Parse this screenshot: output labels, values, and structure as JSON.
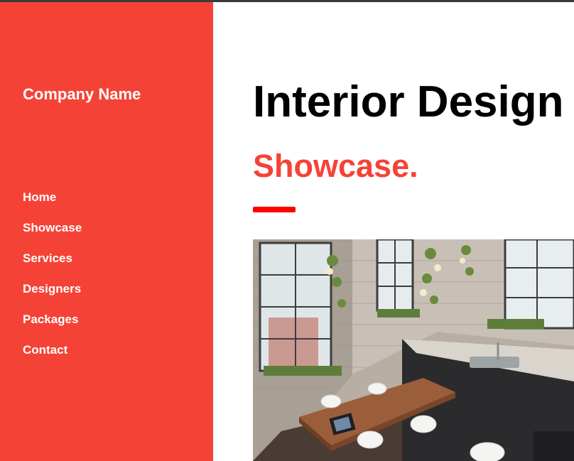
{
  "sidebar": {
    "brand": "Company Name",
    "items": [
      {
        "label": "Home"
      },
      {
        "label": "Showcase"
      },
      {
        "label": "Services"
      },
      {
        "label": "Designers"
      },
      {
        "label": "Packages"
      },
      {
        "label": "Contact"
      }
    ]
  },
  "main": {
    "title": "Interior Design",
    "subtitle": "Showcase."
  },
  "colors": {
    "accent": "#f44336",
    "underline": "#ff0000",
    "text": "#000000",
    "background": "#ffffff"
  }
}
